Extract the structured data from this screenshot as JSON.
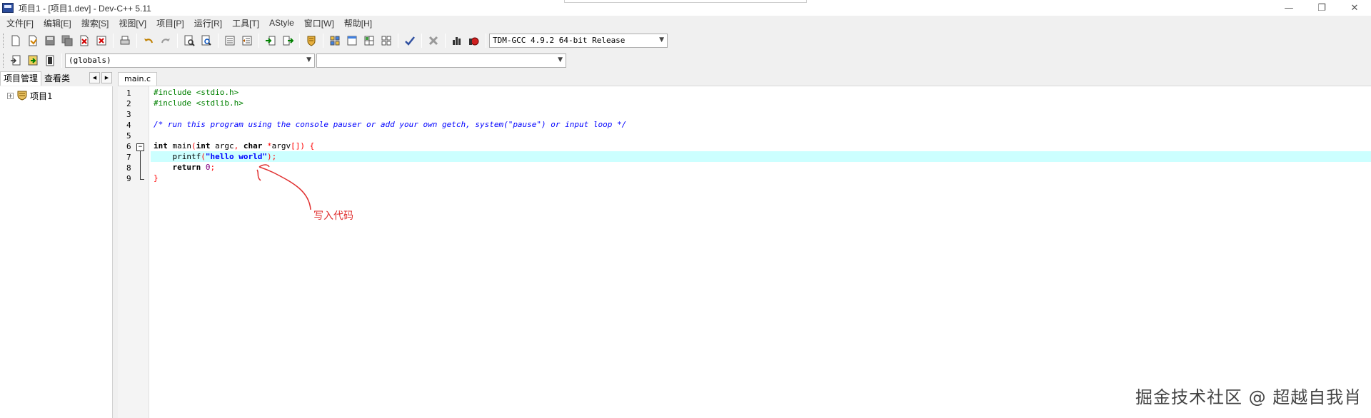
{
  "window": {
    "title": "项目1 - [项目1.dev] - Dev-C++ 5.11",
    "minimize": "—",
    "maximize": "❐",
    "close": "✕"
  },
  "menu": [
    "文件[F]",
    "编辑[E]",
    "搜索[S]",
    "视图[V]",
    "项目[P]",
    "运行[R]",
    "工具[T]",
    "AStyle",
    "窗口[W]",
    "帮助[H]"
  ],
  "toolbar": {
    "compiler": "TDM-GCC 4.9.2 64-bit Release",
    "scope": "(globals)",
    "function": ""
  },
  "left_panel": {
    "tabs": [
      "项目管理",
      "查看类"
    ],
    "nav": [
      "◀",
      "▶"
    ],
    "tree": [
      {
        "label": "项目1",
        "expander": "+"
      }
    ]
  },
  "editor": {
    "tab": "main.c",
    "line_numbers": [
      "1",
      "2",
      "3",
      "4",
      "5",
      "6",
      "7",
      "8",
      "9"
    ],
    "fold_marker": "−",
    "lines": [
      [
        {
          "t": "#include <stdio.h>",
          "c": "pp"
        }
      ],
      [
        {
          "t": "#include <stdlib.h>",
          "c": "pp"
        }
      ],
      [],
      [
        {
          "t": "/* run this program using the console pauser or add your own getch, system(\"pause\") or input loop */",
          "c": "cm"
        }
      ],
      [],
      [
        {
          "t": "int",
          "c": "kw"
        },
        {
          "t": " main",
          "c": "tx"
        },
        {
          "t": "(",
          "c": "sym"
        },
        {
          "t": "int",
          "c": "kw"
        },
        {
          "t": " argc",
          "c": "tx"
        },
        {
          "t": ",",
          "c": "sym"
        },
        {
          "t": " ",
          "c": "tx"
        },
        {
          "t": "char",
          "c": "kw"
        },
        {
          "t": " ",
          "c": "tx"
        },
        {
          "t": "*",
          "c": "sym"
        },
        {
          "t": "argv",
          "c": "tx"
        },
        {
          "t": "[])",
          "c": "sym"
        },
        {
          "t": " ",
          "c": "tx"
        },
        {
          "t": "{",
          "c": "sym"
        }
      ],
      [
        {
          "t": "    printf",
          "c": "tx"
        },
        {
          "t": "(",
          "c": "sym"
        },
        {
          "t": "\"hello world\"",
          "c": "str"
        },
        {
          "t": ");",
          "c": "sym"
        }
      ],
      [
        {
          "t": "    ",
          "c": "tx"
        },
        {
          "t": "return",
          "c": "kw"
        },
        {
          "t": " ",
          "c": "tx"
        },
        {
          "t": "0",
          "c": "num"
        },
        {
          "t": ";",
          "c": "sym"
        }
      ],
      [
        {
          "t": "}",
          "c": "sym"
        }
      ]
    ],
    "highlighted_line": 7
  },
  "annotation": {
    "label": "写入代码",
    "color": "#e03030"
  },
  "watermark": "掘金技术社区 @ 超越自我肖"
}
